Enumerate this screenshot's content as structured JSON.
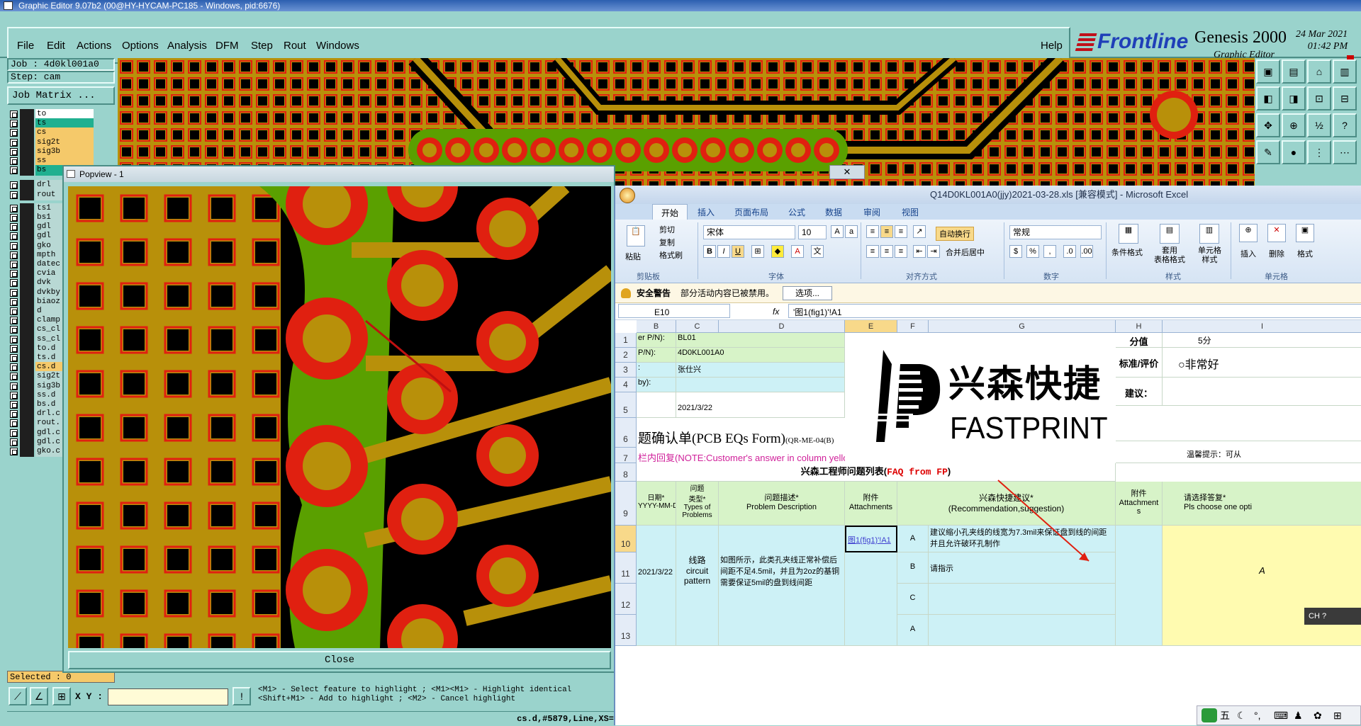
{
  "genesis": {
    "title": "Graphic Editor 9.07b2 (00@HY-HYCAM-PC185 - Windows, pid:6676)",
    "menu": [
      "File",
      "Edit",
      "Actions",
      "Options",
      "Analysis",
      "DFM",
      "Step",
      "Rout",
      "Windows"
    ],
    "help": "Help",
    "brand": "Frontline",
    "product": "Genesis 2000",
    "subtitle": "Graphic Editor",
    "date": "24 Mar 2021",
    "time": "01:42 PM",
    "job": "Job : 4d0kl001a0",
    "step": "Step: cam",
    "job_matrix": "Job Matrix ...",
    "layers": [
      {
        "name": "to",
        "color": "#ffffff"
      },
      {
        "name": "ts",
        "color": "#20b090"
      },
      {
        "name": "cs",
        "color": "#f5c96a"
      },
      {
        "name": "sig2t",
        "color": "#f5c96a"
      },
      {
        "name": "sig3b",
        "color": "#f5c96a"
      },
      {
        "name": "ss",
        "color": "#f5c96a"
      },
      {
        "name": "bs",
        "color": "#20b090"
      },
      {
        "name": "drl",
        "color": "#b8d8d4"
      },
      {
        "name": "rout",
        "color": "#b8d8d4"
      },
      {
        "name": "ts1",
        "color": "#b8d8d4"
      },
      {
        "name": "bs1",
        "color": "#b8d8d4"
      },
      {
        "name": "gdl",
        "color": "#b8d8d4"
      },
      {
        "name": "gdl",
        "color": "#b8d8d4"
      },
      {
        "name": "gko",
        "color": "#b8d8d4"
      },
      {
        "name": "mpth",
        "color": "#b8d8d4"
      },
      {
        "name": "datec",
        "color": "#b8d8d4"
      },
      {
        "name": "cvia",
        "color": "#b8d8d4"
      },
      {
        "name": "dvk",
        "color": "#b8d8d4"
      },
      {
        "name": "dvkby",
        "color": "#b8d8d4"
      },
      {
        "name": "biaoz",
        "color": "#b8d8d4"
      },
      {
        "name": "d",
        "color": "#b8d8d4"
      },
      {
        "name": "clamp",
        "color": "#b8d8d4"
      },
      {
        "name": "cs_cl",
        "color": "#b8d8d4"
      },
      {
        "name": "ss_cl",
        "color": "#b8d8d4"
      },
      {
        "name": "to.d",
        "color": "#b8d8d4"
      },
      {
        "name": "ts.d",
        "color": "#b8d8d4"
      },
      {
        "name": "cs.d",
        "color": "#f5c96a"
      },
      {
        "name": "sig2t",
        "color": "#b8d8d4"
      },
      {
        "name": "sig3b",
        "color": "#b8d8d4"
      },
      {
        "name": "ss.d",
        "color": "#b8d8d4"
      },
      {
        "name": "bs.d",
        "color": "#b8d8d4"
      },
      {
        "name": "drl.c",
        "color": "#b8d8d4"
      },
      {
        "name": "rout.",
        "color": "#b8d8d4"
      },
      {
        "name": "gdl.c",
        "color": "#b8d8d4"
      },
      {
        "name": "gdl.c",
        "color": "#b8d8d4"
      },
      {
        "name": "gko.c",
        "color": "#b8d8d4"
      }
    ],
    "selected": "Selected : 0",
    "popview_title": "Popview - 1",
    "popview_close": "Close",
    "xy_label": "X Y :",
    "hint": "<M1> - Select feature to highlight ; <M1><M1> - Highlight identical\n<Shift+M1> - Add to highlight ; <M2> - Cancel highlight",
    "status": "cs.d,#5879,Line,XS="
  },
  "excel": {
    "title": "Q14D0KL001A0(jjy)2021-03-28.xls  [兼容模式] - Microsoft Excel",
    "tabs": [
      "开始",
      "插入",
      "页面布局",
      "公式",
      "数据",
      "审阅",
      "视图"
    ],
    "clipboard": {
      "paste": "粘贴",
      "cut": "剪切",
      "copy": "复制",
      "format_painter": "格式刷",
      "group": "剪贴板"
    },
    "font": {
      "name": "宋体",
      "size": "10",
      "group": "字体"
    },
    "align": {
      "wrap": "自动换行",
      "merge": "合并后居中",
      "group": "对齐方式"
    },
    "number": {
      "format": "常规",
      "group": "数字"
    },
    "styles": {
      "cond": "条件格式",
      "table": "套用\n表格格式",
      "cell": "单元格\n样式",
      "group": "样式"
    },
    "cells": {
      "insert": "插入",
      "delete": "删除",
      "format": "格式",
      "group": "单元格"
    },
    "security": {
      "label": "安全警告",
      "msg": "部分活动内容已被禁用。",
      "options": "选项..."
    },
    "name_box": "E10",
    "formula": "'图1(fig1)'!A1",
    "columns": [
      "B",
      "C",
      "D",
      "E",
      "F",
      "G",
      "H",
      "I"
    ],
    "rows": [
      "1",
      "2",
      "3",
      "4",
      "5",
      "6",
      "7",
      "8",
      "9",
      "10",
      "11",
      "12",
      "13"
    ],
    "r1": {
      "b": "er P/N):",
      "c": "BL01"
    },
    "r2": {
      "b": "P/N):",
      "c": "4D0KL001A0"
    },
    "r3": {
      "b": ":",
      "c": "张仕兴"
    },
    "r4": {
      "b": "by):"
    },
    "r5": {
      "c": "2021/3/22"
    },
    "r6": {
      "title": "题确认单(PCB EQs Form)",
      "code": "(QR-ME-04(B)"
    },
    "r7": {
      "note": "栏内回复(NOTE:Customer's answer in column yellow area)"
    },
    "r8": {
      "title": "兴森工程师问题列表(",
      "title_red": "FAQ from FP",
      "title_end": ")"
    },
    "headers": {
      "date": "日期*\nYYYY-MM-DD",
      "type": "问题\n类型*\nTypes of\nProblems",
      "desc": "问题描述*\nProblem Description",
      "att": "附件\nAttachments",
      "sugg": "兴森快捷建议*\n(Recommendation,suggestion)",
      "att2": "附件\nAttachment\ns",
      "choose": "请选择答复*\nPls choose one opti"
    },
    "r10": {
      "date": "2021/3/22",
      "type": "线路\ncircuit\npattern",
      "desc": "如图所示，此类孔夹线正常补偿后间距不足4.5mil，并且为2oz的基铜需要保证5mil的盘到线间距",
      "att": "图1(fig1)'!A1",
      "optA": "A",
      "suggA": "建议缩小孔夹线的线宽为7.3mil来保证盘到线的间距并且允许破环孔制作",
      "optB": "B",
      "suggB": "请指示",
      "optC": "C",
      "optA2": "A",
      "choice": "A"
    },
    "right": {
      "score_label": "分值",
      "score": "5分",
      "rating_label": "标准/评价",
      "rating": "○非常好",
      "advice": "建议：",
      "tip": "温馨提示：可从"
    },
    "logo": {
      "cn": "兴森快捷",
      "en": "FASTPRINT"
    },
    "ime": {
      "chars": "五",
      "ch": "CH"
    }
  }
}
